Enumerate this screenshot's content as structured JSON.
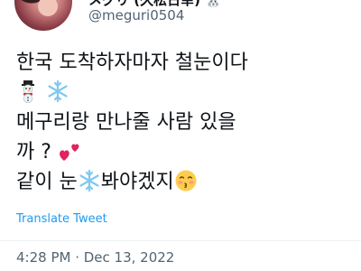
{
  "author": {
    "display_name": "メグリ (久松日幸) 🐰",
    "handle": "@meguri0504",
    "more_label": "···"
  },
  "tweet": {
    "line1": "한국 도착하자마자 철눈이다",
    "line3": "메구리랑 만나줄 사람 있을",
    "line4": "까 ?",
    "line5a": "같이 눈",
    "line5b": "봐야겠지"
  },
  "actions": {
    "translate_label": "Translate Tweet"
  },
  "meta": {
    "timestamp": "4:28 PM · Dec 13, 2022"
  },
  "icons": [
    "snowman-icon",
    "snowflake-icon",
    "two-hearts-icon",
    "kissing-face-icon"
  ],
  "colors": {
    "link": "#1d9bf0",
    "secondary_text": "#536471",
    "text": "#0f1419",
    "snowflake": "#7fc8f0",
    "heart": "#e0245e"
  }
}
